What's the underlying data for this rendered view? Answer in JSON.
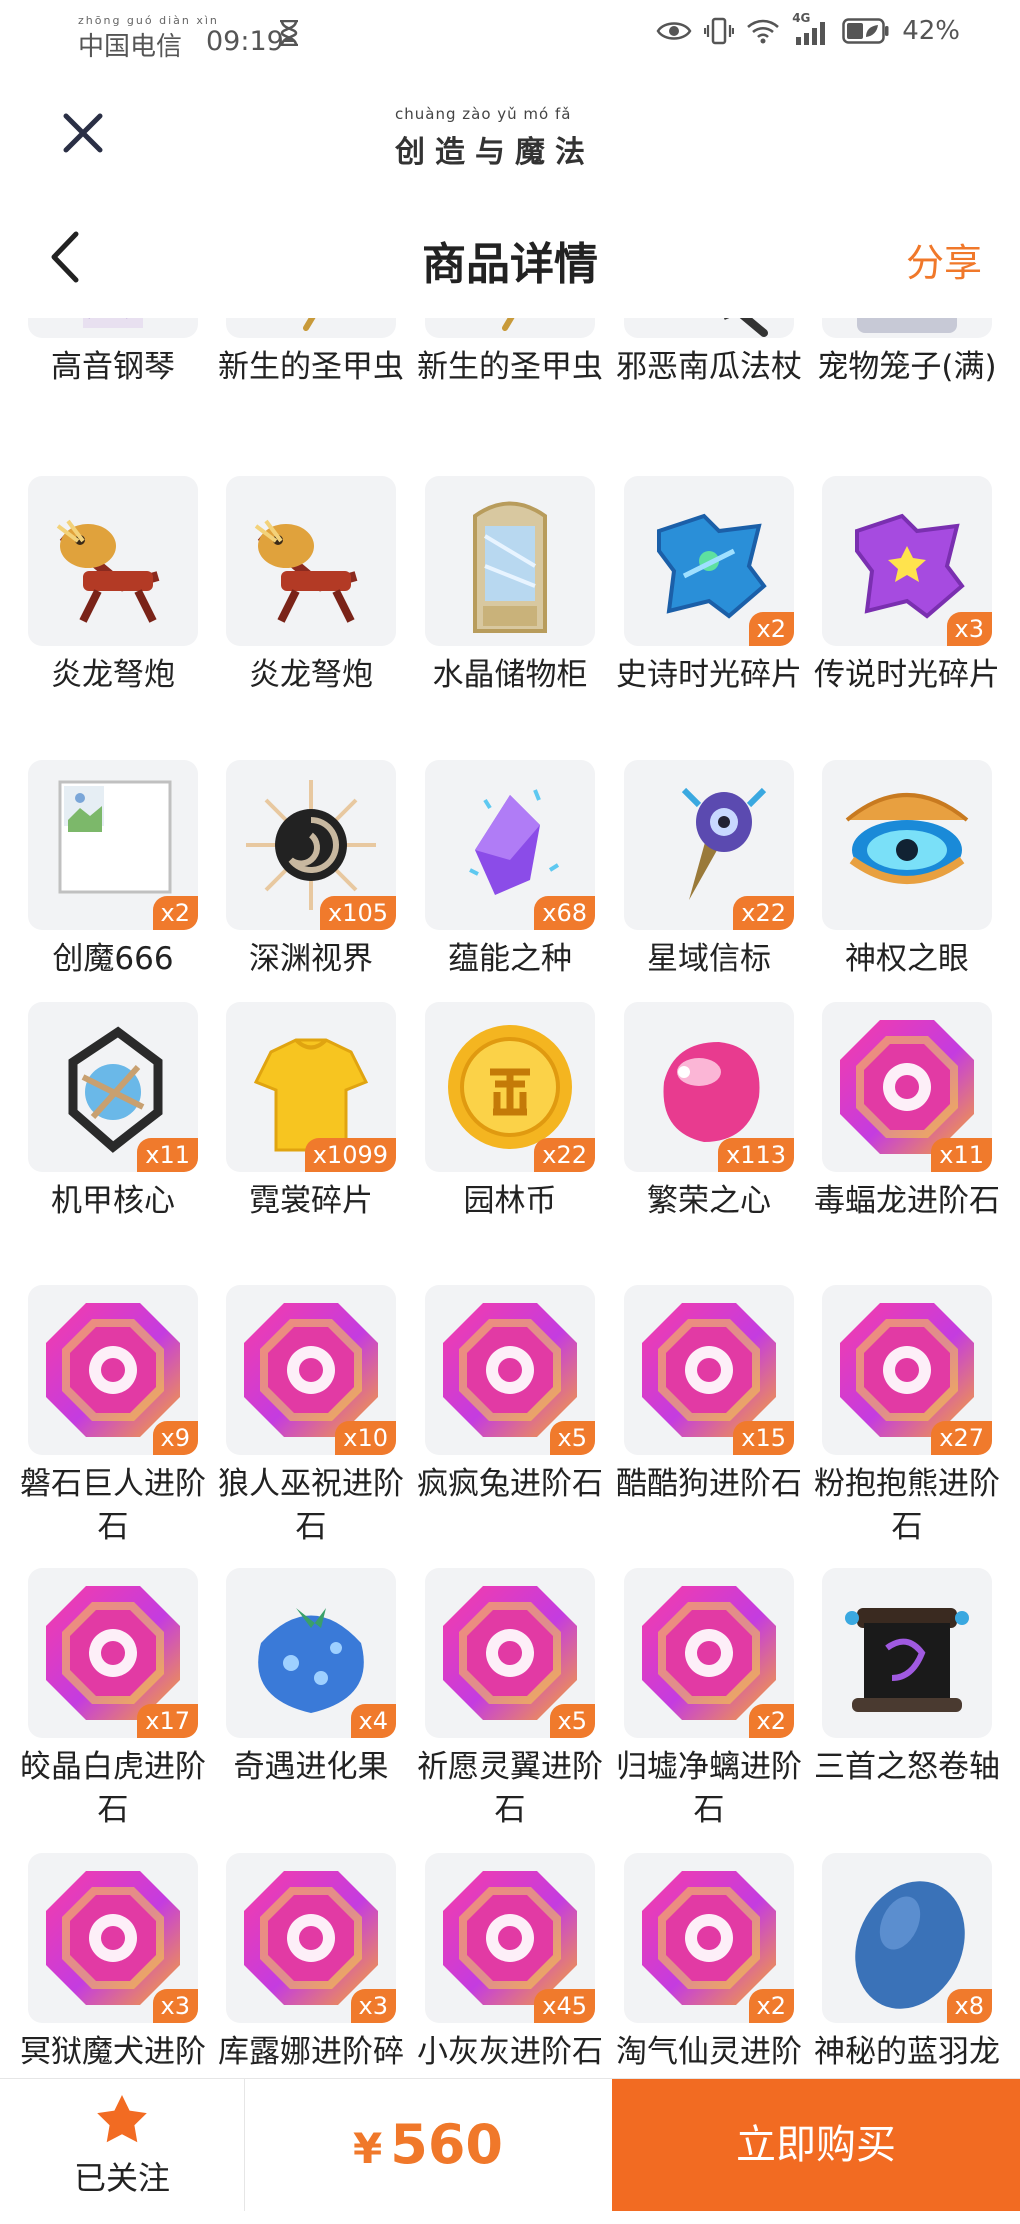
{
  "status_bar": {
    "carrier_pinyin": "zhōng guó diàn xìn",
    "carrier": "中国电信",
    "time": "09:19",
    "network": "4G",
    "battery": "42%"
  },
  "header": {
    "logo_pinyin": "chuàng zào yǔ mó fǎ",
    "logo_text": "创造与魔法",
    "title": "商品详情",
    "share_label": "分享"
  },
  "items": [
    {
      "name": "高音钢琴",
      "badge": "",
      "icon": "piano-icon"
    },
    {
      "name": "新生的圣甲虫",
      "badge": "",
      "icon": "scarab-icon"
    },
    {
      "name": "新生的圣甲虫",
      "badge": "",
      "icon": "scarab-icon"
    },
    {
      "name": "邪恶南瓜法杖",
      "badge": "",
      "icon": "staff-icon"
    },
    {
      "name": "宠物笼子(满)",
      "badge": "",
      "icon": "cage-icon"
    },
    {
      "name": "炎龙弩炮",
      "badge": "",
      "icon": "dragon-ballista-icon"
    },
    {
      "name": "炎龙弩炮",
      "badge": "",
      "icon": "dragon-ballista-icon"
    },
    {
      "name": "水晶储物柜",
      "badge": "",
      "icon": "crystal-cabinet-icon"
    },
    {
      "name": "史诗时光碎片",
      "badge": "x2",
      "icon": "epic-fragment-icon"
    },
    {
      "name": "传说时光碎片",
      "badge": "x3",
      "icon": "legend-fragment-icon"
    },
    {
      "name": "创魔666",
      "badge": "x2",
      "icon": "broken-image-icon"
    },
    {
      "name": "深渊视界",
      "badge": "x105",
      "icon": "abyss-icon"
    },
    {
      "name": "蕴能之种",
      "badge": "x68",
      "icon": "crystal-seed-icon"
    },
    {
      "name": "星域信标",
      "badge": "x22",
      "icon": "beacon-icon"
    },
    {
      "name": "神权之眼",
      "badge": "",
      "icon": "eye-icon"
    },
    {
      "name": "机甲核心",
      "badge": "x11",
      "icon": "mech-core-icon"
    },
    {
      "name": "霓裳碎片",
      "badge": "x1099",
      "icon": "shirt-icon"
    },
    {
      "name": "园林币",
      "badge": "x22",
      "icon": "coin-icon"
    },
    {
      "name": "繁荣之心",
      "badge": "x113",
      "icon": "heart-gem-icon"
    },
    {
      "name": "毒蝠龙进阶石",
      "badge": "x11",
      "icon": "advancement-stone-icon"
    },
    {
      "name": "磐石巨人进阶石",
      "badge": "x9",
      "icon": "advancement-stone-icon"
    },
    {
      "name": "狼人巫祝进阶石",
      "badge": "x10",
      "icon": "advancement-stone-icon"
    },
    {
      "name": "疯疯兔进阶石",
      "badge": "x5",
      "icon": "advancement-stone-icon"
    },
    {
      "name": "酷酷狗进阶石",
      "badge": "x15",
      "icon": "advancement-stone-icon"
    },
    {
      "name": "粉抱抱熊进阶石",
      "badge": "x27",
      "icon": "advancement-stone-icon"
    },
    {
      "name": "皎晶白虎进阶石",
      "badge": "x17",
      "icon": "advancement-stone-icon"
    },
    {
      "name": "奇遇进化果",
      "badge": "x4",
      "icon": "evolution-fruit-icon"
    },
    {
      "name": "祈愿灵翼进阶石",
      "badge": "x5",
      "icon": "advancement-stone-icon"
    },
    {
      "name": "归墟净螭进阶石",
      "badge": "x2",
      "icon": "advancement-stone-icon"
    },
    {
      "name": "三首之怒卷轴",
      "badge": "",
      "icon": "scroll-icon"
    },
    {
      "name": "冥狱魔犬进阶石",
      "badge": "x3",
      "icon": "advancement-stone-icon"
    },
    {
      "name": "库露娜进阶碎片",
      "badge": "x3",
      "icon": "advancement-stone-icon"
    },
    {
      "name": "小灰灰进阶石",
      "badge": "x45",
      "icon": "advancement-stone-icon"
    },
    {
      "name": "淘气仙灵进阶石",
      "badge": "x2",
      "icon": "advancement-stone-icon"
    },
    {
      "name": "神秘的蓝羽龙蛋",
      "badge": "x8",
      "icon": "blue-egg-icon"
    }
  ],
  "bottom_bar": {
    "follow_label": "已关注",
    "currency": "¥",
    "price": "560",
    "buy_label": "立即购买"
  },
  "colors": {
    "accent": "#f07a2c",
    "buy_button": "#f26b22",
    "tile_bg": "#f2f3f5"
  }
}
